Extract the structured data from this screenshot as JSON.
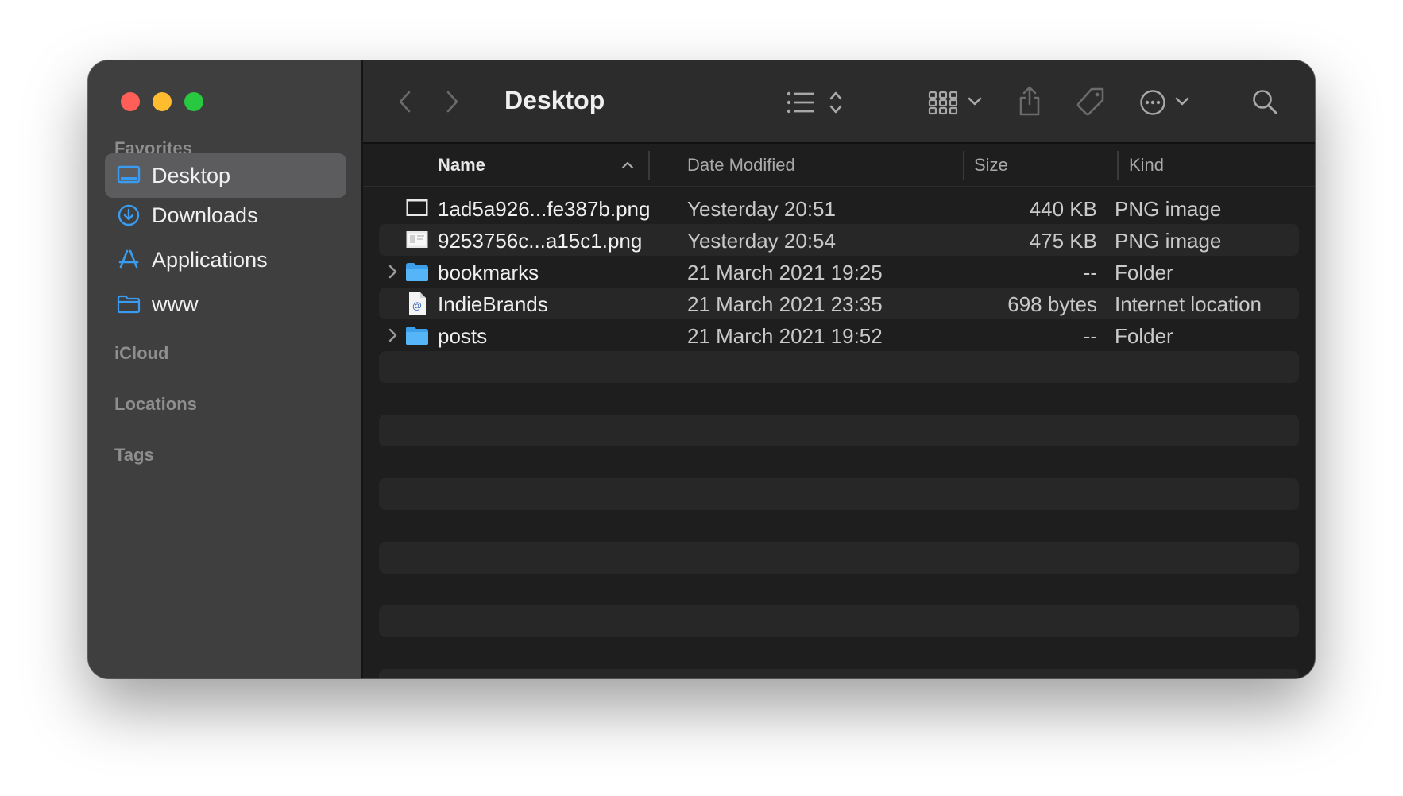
{
  "sidebar": {
    "favorites_label": "Favorites",
    "items": [
      {
        "label": "Desktop",
        "icon": "desktop-icon",
        "selected": true
      },
      {
        "label": "Downloads",
        "icon": "download-icon",
        "selected": false
      },
      {
        "label": "Applications",
        "icon": "applications-icon",
        "selected": false
      },
      {
        "label": "www",
        "icon": "folder-icon",
        "selected": false
      }
    ],
    "icloud_label": "iCloud",
    "locations_label": "Locations",
    "tags_label": "Tags"
  },
  "toolbar": {
    "title": "Desktop",
    "icons": [
      "chevron-left-icon",
      "chevron-right-icon",
      "list-view-icon",
      "sort-arrows-icon",
      "grid-view-icon",
      "chevron-down-icon",
      "share-icon",
      "tag-icon",
      "more-icon",
      "chevron-down-icon",
      "search-icon"
    ]
  },
  "columns": {
    "name": "Name",
    "date": "Date Modified",
    "size": "Size",
    "kind": "Kind"
  },
  "files": [
    {
      "name": "1ad5a926...fe387b.png",
      "date": "Yesterday 20:51",
      "size": "440 KB",
      "kind": "PNG image",
      "icon": "image-file-icon",
      "expandable": false
    },
    {
      "name": "9253756c...a15c1.png",
      "date": "Yesterday 20:54",
      "size": "475 KB",
      "kind": "PNG image",
      "icon": "image-file-icon",
      "expandable": false
    },
    {
      "name": "bookmarks",
      "date": "21 March 2021 19:25",
      "size": "--",
      "kind": "Folder",
      "icon": "folder-icon",
      "expandable": true
    },
    {
      "name": "IndieBrands",
      "date": "21 March 2021 23:35",
      "size": "698 bytes",
      "kind": "Internet location",
      "icon": "internet-location-icon",
      "expandable": false
    },
    {
      "name": "posts",
      "date": "21 March 2021 19:52",
      "size": "--",
      "kind": "Folder",
      "icon": "folder-icon",
      "expandable": true
    }
  ],
  "colors": {
    "accent": "#3a9cf0",
    "traffic_red": "#ff5f57",
    "traffic_yellow": "#febc2e",
    "traffic_green": "#28c840"
  }
}
